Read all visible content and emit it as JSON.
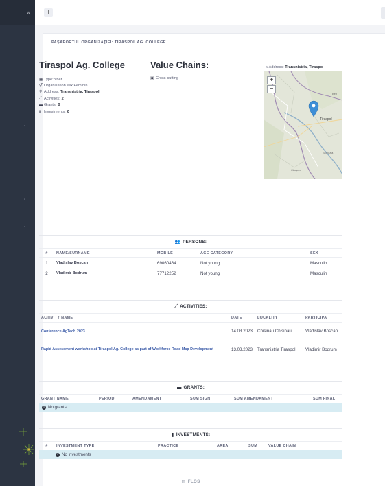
{
  "sidebar": {
    "brand_icon": "chevrons-left-icon",
    "chevrons": [
      "chevron-left-icon",
      "chevron-left-icon",
      "chevron-left-icon"
    ]
  },
  "topbar": {
    "toggle_label": "I"
  },
  "page": {
    "title": "PAŞAPORTUL ORGANIZAŢIEI: TIRASPOL AG. COLLEGE"
  },
  "org": {
    "name": "Tiraspol Ag. College",
    "type_label": "Type: ",
    "type_value": "other",
    "sex_label": "Organisation sex: ",
    "sex_value": "Feminin",
    "address_label": "Address: ",
    "address_value": "Transnistria, Tiraspol",
    "activities_label": "Activities: ",
    "activities_value": "2",
    "grants_label": "Grants: ",
    "grants_value": "0",
    "investments_label": "Investments: ",
    "investments_value": "0"
  },
  "value_chains": {
    "title": "Value Chains:",
    "items": [
      "Cross-cutting"
    ]
  },
  "map": {
    "address_label": "Address: ",
    "address_value": "Transnistria, Tiraspo",
    "zoom_in": "+",
    "zoom_out": "−",
    "labels": [
      "Tiraspol",
      "Ben",
      "Slobozia",
      "Căușeni"
    ]
  },
  "persons": {
    "title": "PERSONS:",
    "columns": [
      "#",
      "NAME/SURNAME",
      "MOBILE",
      "AGE CATEGORY",
      "SEX"
    ],
    "rows": [
      [
        "1",
        "Vladislav Boscan",
        "69060464",
        "Not young",
        "Masculin"
      ],
      [
        "2",
        "Vladimir Bodrum",
        "77712252",
        "Not young",
        "Masculin"
      ]
    ]
  },
  "activities": {
    "title": "ACTIVITIES:",
    "columns": [
      "ACTIVITY NAME",
      "DATE",
      "LOCALITY",
      "PARTICIPA"
    ],
    "rows": [
      [
        "Conference AgTech 2023",
        "14.03.2023",
        "Chisinau Chisinau",
        "Vladislav Boscan"
      ],
      [
        "Rapid Assessment workshop at Tiraspol Ag. College as part of Workforce Road Map Development",
        "13.03.2023",
        "Transnistria Tiraspol",
        "Vladimir Bodrum"
      ]
    ]
  },
  "grants": {
    "title": "GRANTS:",
    "columns": [
      "GRANT NAME",
      "PERIOD",
      "AMENDAMENT",
      "SUM SIGN",
      "SUM AMENDAMENT",
      "SUM FINAL"
    ],
    "empty": "No grants"
  },
  "investments": {
    "title": "INVESTMENTS:",
    "columns": [
      "#",
      "INVESTMENT TYPE",
      "PRACTICE",
      "AREA",
      "SUM",
      "VALUE CHAIN"
    ],
    "empty": "No investments"
  },
  "next_section": {
    "title": "FLOS"
  },
  "colors": {
    "sidebar": "#2c3442",
    "link": "#3b5ba8",
    "alert": "#d7ecf3"
  }
}
